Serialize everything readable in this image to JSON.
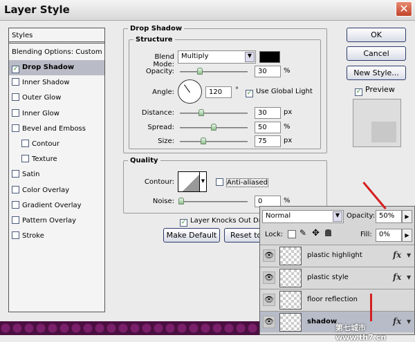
{
  "window": {
    "title": "Layer Style",
    "close_icon": "close-icon"
  },
  "styles": {
    "header": "Styles",
    "blending": "Blending Options: Custom",
    "items": [
      {
        "label": "Drop Shadow",
        "checked": true,
        "selected": true
      },
      {
        "label": "Inner Shadow",
        "checked": false
      },
      {
        "label": "Outer Glow",
        "checked": false
      },
      {
        "label": "Inner Glow",
        "checked": false
      },
      {
        "label": "Bevel and Emboss",
        "checked": false
      },
      {
        "label": "Contour",
        "checked": false,
        "sub": true
      },
      {
        "label": "Texture",
        "checked": false,
        "sub": true
      },
      {
        "label": "Satin",
        "checked": false
      },
      {
        "label": "Color Overlay",
        "checked": false
      },
      {
        "label": "Gradient Overlay",
        "checked": false
      },
      {
        "label": "Pattern Overlay",
        "checked": false
      },
      {
        "label": "Stroke",
        "checked": false
      }
    ]
  },
  "drop_shadow": {
    "title": "Drop Shadow",
    "structure": "Structure",
    "blend_mode_label": "Blend Mode:",
    "blend_mode": "Multiply",
    "color": "#000000",
    "opacity_label": "Opacity:",
    "opacity": "30",
    "opacity_unit": "%",
    "angle_label": "Angle:",
    "angle": "120",
    "angle_unit": "°",
    "use_global_light": "Use Global Light",
    "distance_label": "Distance:",
    "distance": "30",
    "distance_unit": "px",
    "spread_label": "Spread:",
    "spread": "50",
    "spread_unit": "%",
    "size_label": "Size:",
    "size": "75",
    "size_unit": "px",
    "quality": "Quality",
    "contour_label": "Contour:",
    "anti_aliased": "Anti-aliased",
    "noise_label": "Noise:",
    "noise": "0",
    "noise_unit": "%",
    "knocks_out": "Layer Knocks Out Dro",
    "make_default": "Make Default",
    "reset": "Reset to D"
  },
  "buttons": {
    "ok": "OK",
    "cancel": "Cancel",
    "new_style": "New Style...",
    "preview": "Preview"
  },
  "layers": {
    "blend_mode": "Normal",
    "opacity_label": "Opacity:",
    "opacity": "50%",
    "lock_label": "Lock:",
    "fill_label": "Fill:",
    "fill": "0%",
    "items": [
      {
        "name": "plastic highlight",
        "fx": "fx"
      },
      {
        "name": "plastic style",
        "fx": "fx"
      },
      {
        "name": "floor reflection",
        "fx": ""
      },
      {
        "name": "shadow",
        "fx": "fx",
        "selected": true
      }
    ]
  },
  "watermark": "第七城市 www.th7.cn"
}
